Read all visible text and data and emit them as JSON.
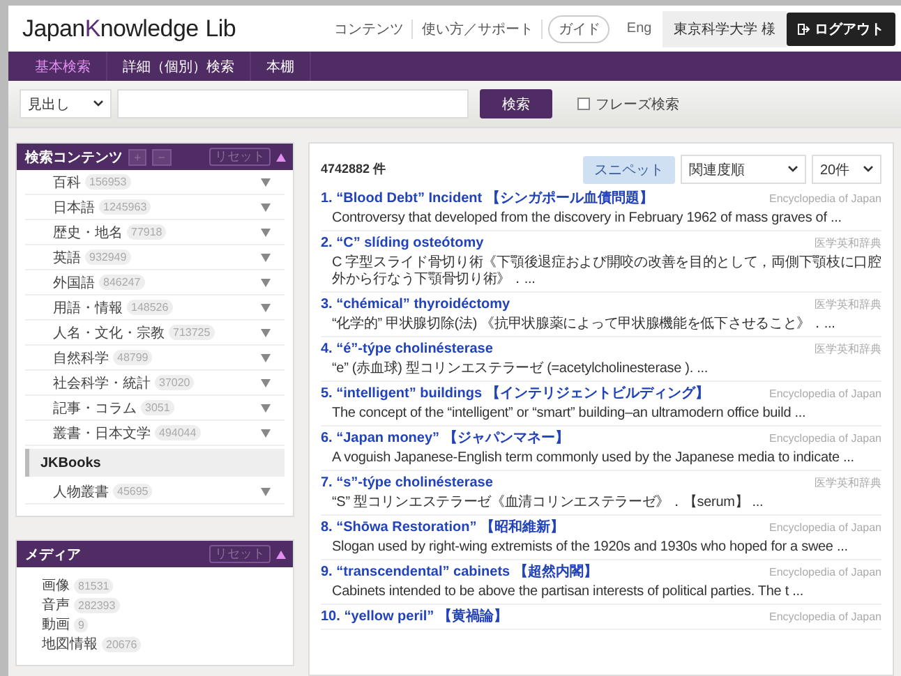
{
  "header": {
    "logo": {
      "part_1": "Japan",
      "part_2": "K",
      "part_3": "nowledge",
      "part_4": "Lib"
    },
    "links": [
      "コンテンツ",
      "使い方／サポート"
    ],
    "guide_button": "ガイド",
    "language_link": "Eng",
    "user": "東京科学大学 様",
    "logout_button": "ログアウト"
  },
  "nav_tabs": [
    {
      "label": "基本検索",
      "selected": true
    },
    {
      "label": "詳細（個別）検索",
      "selected": false
    },
    {
      "label": "本棚",
      "selected": false
    }
  ],
  "search_bar": {
    "scope": "見出し",
    "search_button": "検索",
    "phrase_search": {
      "label": "フレーズ検索",
      "checked": false
    }
  },
  "sidebar": {
    "panels": [
      {
        "title": "検索コンテンツ",
        "expand_button": "+",
        "collapse_button": "−",
        "reset_button": "リセット",
        "items": [
          {
            "kind": "item",
            "label": "百科",
            "count": "156953"
          },
          {
            "kind": "item",
            "label": "日本語",
            "count": "1245963"
          },
          {
            "kind": "item",
            "label": "歴史・地名",
            "count": "77918"
          },
          {
            "kind": "item",
            "label": "英語",
            "count": "932949"
          },
          {
            "kind": "item",
            "label": "外国語",
            "count": "846247"
          },
          {
            "kind": "item",
            "label": "用語・情報",
            "count": "148526"
          },
          {
            "kind": "item",
            "label": "人名・文化・宗教",
            "count": "713725"
          },
          {
            "kind": "item",
            "label": "自然科学",
            "count": "48799"
          },
          {
            "kind": "item",
            "label": "社会科学・統計",
            "count": "37020"
          },
          {
            "kind": "item",
            "label": "記事・コラム",
            "count": "3051"
          },
          {
            "kind": "item",
            "label": "叢書・日本文学",
            "count": "494044"
          },
          {
            "kind": "heading",
            "label": "JKBooks"
          },
          {
            "kind": "item",
            "label": "人物叢書",
            "count": "45695"
          }
        ]
      },
      {
        "title": "メディア",
        "reset_button": "リセット",
        "items": [
          {
            "kind": "plain",
            "label": "画像",
            "count": "81531"
          },
          {
            "kind": "plain",
            "label": "音声",
            "count": "282393"
          },
          {
            "kind": "plain",
            "label": "動画",
            "count": "9"
          },
          {
            "kind": "plain",
            "label": "地図情報",
            "count": "20676"
          }
        ]
      }
    ]
  },
  "results": {
    "count": "4742882 件",
    "snippet_button": "スニペット",
    "sort": "関連度順",
    "per_page": "20件",
    "items": [
      {
        "number": "1.",
        "title": "“Blood Debt” Incident",
        "title_ja": "【シンガポール血債問題】",
        "source": "Encyclopedia of Japan",
        "snippet": "Controversy that developed from the discovery in February 1962 of mass graves of ..."
      },
      {
        "number": "2.",
        "title": "“C” slíding osteótomy",
        "source": "医学英和辞典",
        "snippet": "C 字型スライド骨切り術《下顎後退症および開咬の改善を目的として，両側下顎枝に口腔外から行なう下顎骨切り術》．..."
      },
      {
        "number": "3.",
        "title": "“chémical” thyroidéctomy",
        "source": "医学英和辞典",
        "snippet": "“化学的” 甲状腺切除(法) 《抗甲状腺薬によって甲状腺機能を低下させること》．..."
      },
      {
        "number": "4.",
        "title": "“é”-týpe cholinésterase",
        "source": "医学英和辞典",
        "snippet": "“e” (赤血球) 型コリンエステラーゼ (=acetylcholinesterase ). ..."
      },
      {
        "number": "5.",
        "title": "“intelligent” buildings",
        "title_ja": "【インテリジェントビルディング】",
        "source": "Encyclopedia of Japan",
        "snippet": "The concept of the “intelligent” or “smart” building–an ultramodern office build ..."
      },
      {
        "number": "6.",
        "title": "“Japan money”",
        "title_ja": "【ジャパンマネー】",
        "source": "Encyclopedia of Japan",
        "snippet": "A voguish Japanese-English term commonly used by the Japanese media to indicate ..."
      },
      {
        "number": "7.",
        "title": "“s”-týpe cholinésterase",
        "source": "医学英和辞典",
        "snippet": "“S” 型コリンエステラーゼ《血清コリンエステラーゼ》．【serum】 ..."
      },
      {
        "number": "8.",
        "title": "“Shōwa Restoration”",
        "title_ja": "【昭和維新】",
        "source": "Encyclopedia of Japan",
        "snippet": "Slogan used by right-wing extremists of the 1920s and 1930s who hoped for a swee ..."
      },
      {
        "number": "9.",
        "title": "“transcendental” cabinets",
        "title_ja": "【超然内閣】",
        "source": "Encyclopedia of Japan",
        "snippet": "Cabinets intended to be above the partisan interests of political parties. The t ..."
      },
      {
        "number": "10.",
        "title": "“yellow peril”",
        "title_ja": "【黄禍論】",
        "source": "Encyclopedia of Japan"
      }
    ]
  }
}
